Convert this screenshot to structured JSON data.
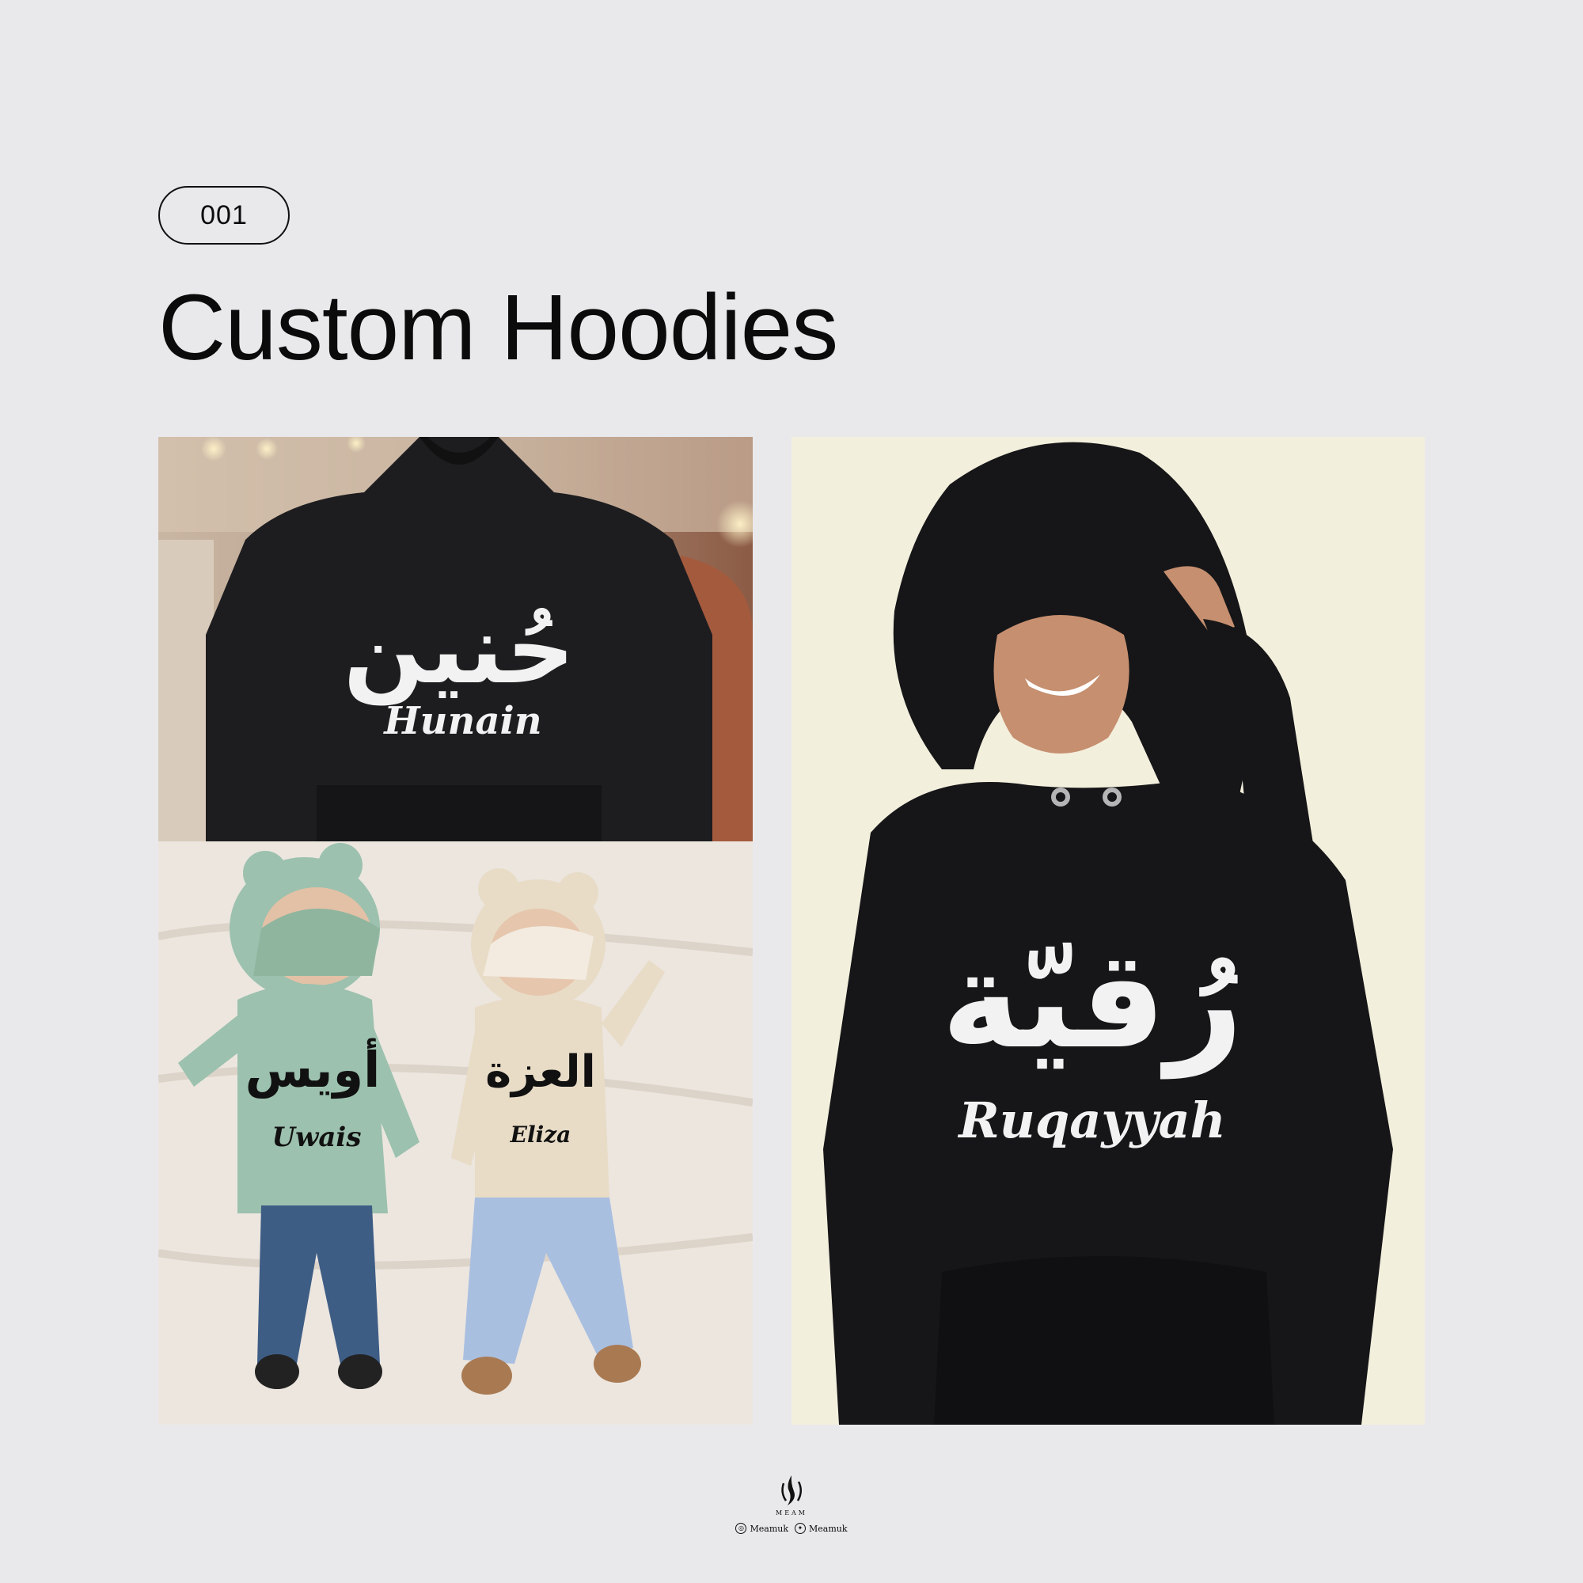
{
  "badge": {
    "number": "001"
  },
  "page": {
    "title": "Custom Hoodies"
  },
  "photos": {
    "hunain": {
      "name_ar": "حُنين",
      "name_en": "Hunain"
    },
    "uwais": {
      "name_ar": "أويس",
      "name_en": "Uwais"
    },
    "eliza": {
      "name_ar": "العزة",
      "name_en": "Eliza"
    },
    "ruqayyah": {
      "name_ar": "رُقيّة",
      "name_en": "Ruqayyah"
    }
  },
  "footer": {
    "brand": "MEAM",
    "instagram_handle": "Meamuk",
    "twitter_handle": "Meamuk",
    "instagram_icon": "instagram-icon",
    "twitter_icon": "twitter-icon"
  }
}
